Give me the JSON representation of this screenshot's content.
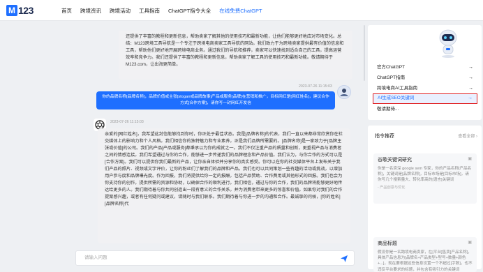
{
  "header": {
    "logo_mark": "M",
    "logo_text": "123",
    "nav": [
      "首页",
      "跨境资讯",
      "跨境活动",
      "工具指南",
      "ChatGPT指令大全",
      "在线免费ChatGPT"
    ]
  },
  "chat": {
    "ai_top_text": "还提供了丰富的教程和更新信息，帮助卖家了解其他的使用技巧和最新功能，让他们能够更好地应对市场变化。总结：M123跨境工具导航是一个专注于跨境电商卖家工具导航的网站。我们致力于为跨境卖家提供最有价值的信息和工具，帮助他们更好地开展跨境电商业务。通过我们的导航和推荐，卖家可以快速找到适合自己的工具，提高运营效率和竞争力。我们还提供了丰富的教程和更新信息，帮助卖家了解工具的使用技巧和最新功能。敬请期待于M123.com，让出海更简单。",
    "ts1": "2023-07-26 11:15:03",
    "user_text": "你的品牌名称[品牌名称]，品牌价值或主张[slogan或品牌故事]产品或服务[品牌]在营销和推广，目标网红是[网红姓名]，建议合作方式[合作方案]，请你写一封网红开发信",
    "ts2": "2023-07-26 11:15:03",
    "ai_main_text": "亲爱的[网红姓名]，我希望这封信能够找到你时，你正处于最佳状态。我是[品牌名称]的代表，我们一直以来都非常欣赏你在社交媒体上的影响力和个人风格。我们相信你的独特魅力和专业素养，正是我们品牌所需要的。[品牌名称]是一家致力于[品牌主张或价值]的公司。我们的产品[产品或服务]都秉承以为你的成就之一。我们不仅注重产品的质量和创新，更重视产品与消费者之间的情感连接。我们希望通过与你的合作，能够进一步传递我们的品牌理念和产品价值。我们认为，与你合作的方式可以是[合作方案]。我们可以提供你我们最新的产品，让你亲自体验并分享你的真实感受。你可以在你的社交媒体平台上发布关于我们产品的照片、视频或文字评价，让你的粉丝们了解我们的品牌和产品。我们也可以共同策划一些有趣的活动或挑战，以增加用户参与度和品牌曝光度。作为回报，我们将提供给你一定的报酬，包括产品赞助、合作费用或其他形式的回报。我们也会为你支持你的创作，提供所需的资源和协助，以确保合作的顺利进行。我们相信，通过与你的合作，我们的品牌将能够更好地传达给更多的人。我们期待着与你共同创造出一段有意义的合作关系，并为消费者带来更多的惊喜和价值。如果你对我们的合作提案感兴趣，或者有任何疑问或建议，请随时与我们联系。我们期待着与你进一步的沟通和合作。最诚挚的问候，[你的姓名][品牌名称]代",
    "input_placeholder": "请输入问题"
  },
  "sidebar": {
    "menu": [
      {
        "label": "官方ChatGPT",
        "arrow": "→"
      },
      {
        "label": "ChatGPT指南",
        "arrow": "→"
      },
      {
        "label": "跨境电商AI工具指南",
        "arrow": "→"
      },
      {
        "label": "AI生成SEO关键词",
        "arrow": "→"
      },
      {
        "label": "敬请期待...",
        "arrow": ""
      }
    ],
    "recommend_title": "指令推荐",
    "recommend_more": "查看全部 ›",
    "cards": [
      {
        "title": "谷歌关键词研究",
        "body": "你是一名资深 google sem 专家，你的产品名称[产品名称]，关键词是[品牌名称]，目标市场是[目标市场]，请你写几个搜索量大、转化率高的[语言]关键词",
        "tag": "- 产品创意与优化"
      },
      {
        "title": "商品标题",
        "body": "假设你是一名跨境电商卖家，在[平台]售卖[产品名称]，具体产品信息为[品牌名+产品类型+型号+数量+颜色+...]，现在要根据这些信息设置一个不超过[字数]，也不违反平台要求的标题，并包含有吸引力的关键词",
        "tag": ""
      }
    ]
  },
  "colors": {
    "accent": "#1e6fff",
    "highlight_border": "#e0191b"
  }
}
